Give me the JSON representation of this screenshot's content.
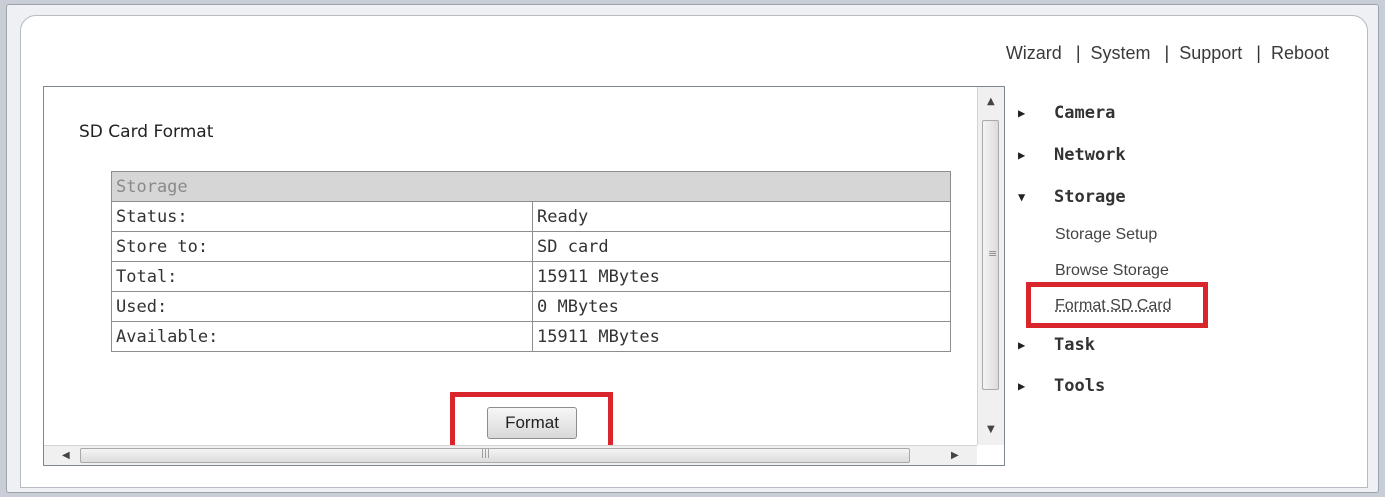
{
  "top_nav": {
    "items": [
      "Wizard",
      "System",
      "Support",
      "Reboot"
    ],
    "separator": "|"
  },
  "content": {
    "title": "SD Card Format",
    "table": {
      "header": "Storage",
      "rows": [
        {
          "label": "Status:",
          "value": "Ready"
        },
        {
          "label": "Store to:",
          "value": "SD card"
        },
        {
          "label": "Total:",
          "value": "15911 MBytes"
        },
        {
          "label": "Used:",
          "value": "0 MBytes"
        },
        {
          "label": "Available:",
          "value": "15911 MBytes"
        }
      ]
    },
    "format_button": "Format"
  },
  "side_menu": {
    "camera": "Camera",
    "network": "Network",
    "storage": "Storage",
    "storage_sub": [
      "Storage Setup",
      "Browse Storage",
      "Format SD Card"
    ],
    "task": "Task",
    "tools": "Tools"
  },
  "colors": {
    "highlight": "#d9262c",
    "table_header_bg": "#d6d6d6"
  },
  "icons": {
    "collapsed": "triangle-right-icon",
    "expanded": "triangle-down-icon"
  }
}
